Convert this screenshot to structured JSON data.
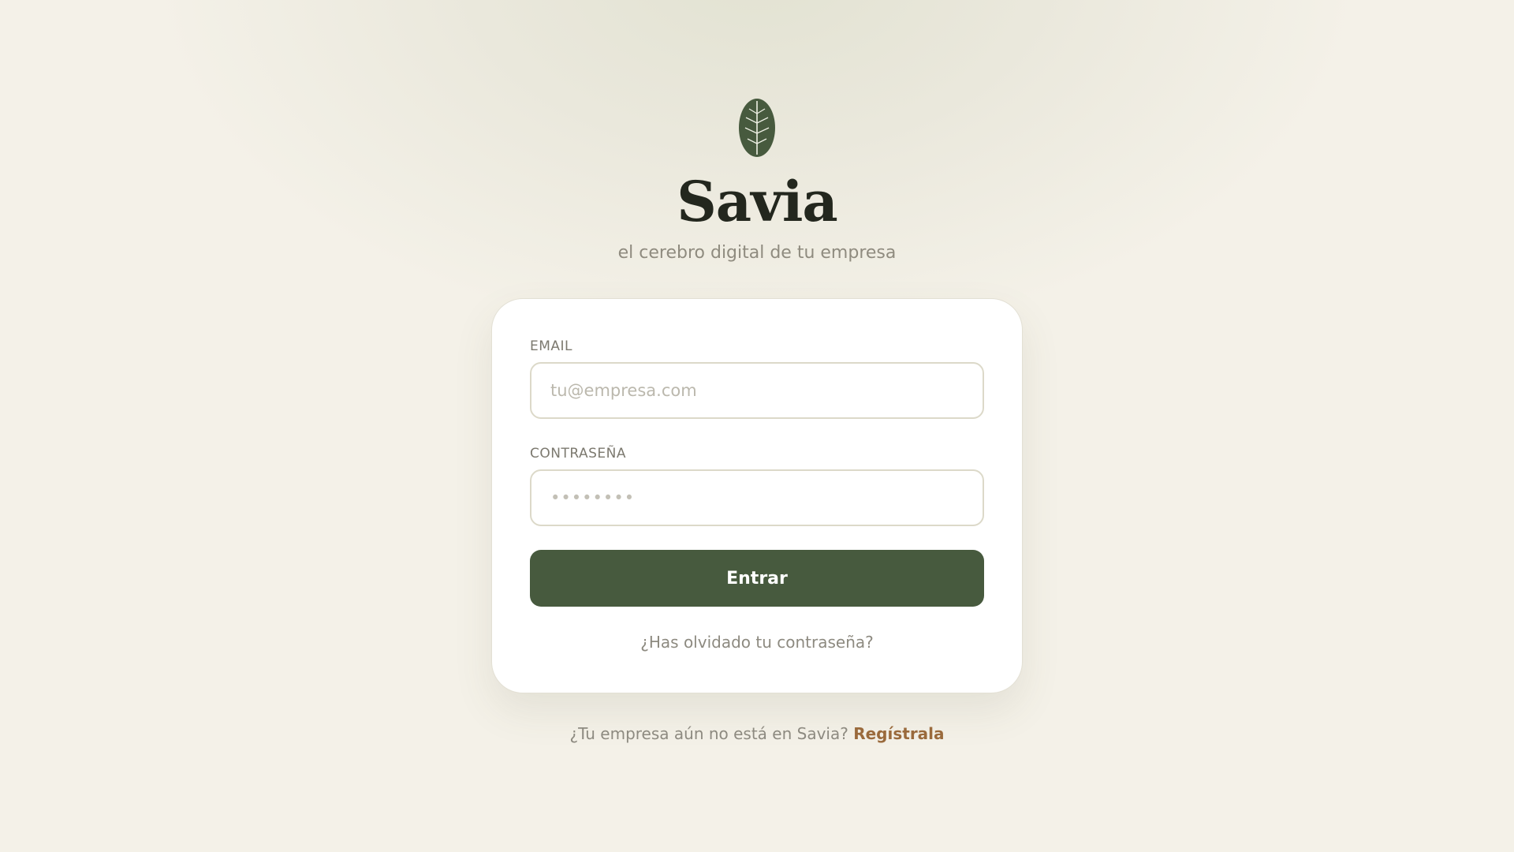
{
  "brand": {
    "logo_icon": "leaf-icon",
    "name": "Savia",
    "tagline": "el cerebro digital de tu empresa"
  },
  "login": {
    "email_label": "EMAIL",
    "email_placeholder": "tu@empresa.com",
    "email_value": "",
    "password_label": "CONTRASEÑA",
    "password_placeholder": "••••••••",
    "password_value": "",
    "submit_label": "Entrar",
    "forgot_link": "¿Has olvidado tu contraseña?"
  },
  "signup": {
    "prompt": "¿Tu empresa aún no está en Savia?",
    "link": "Regístrala"
  },
  "colors": {
    "primary": "#475a3e",
    "accent_link": "#9a6a3c",
    "background": "#f4f1e8",
    "card": "#ffffff"
  }
}
